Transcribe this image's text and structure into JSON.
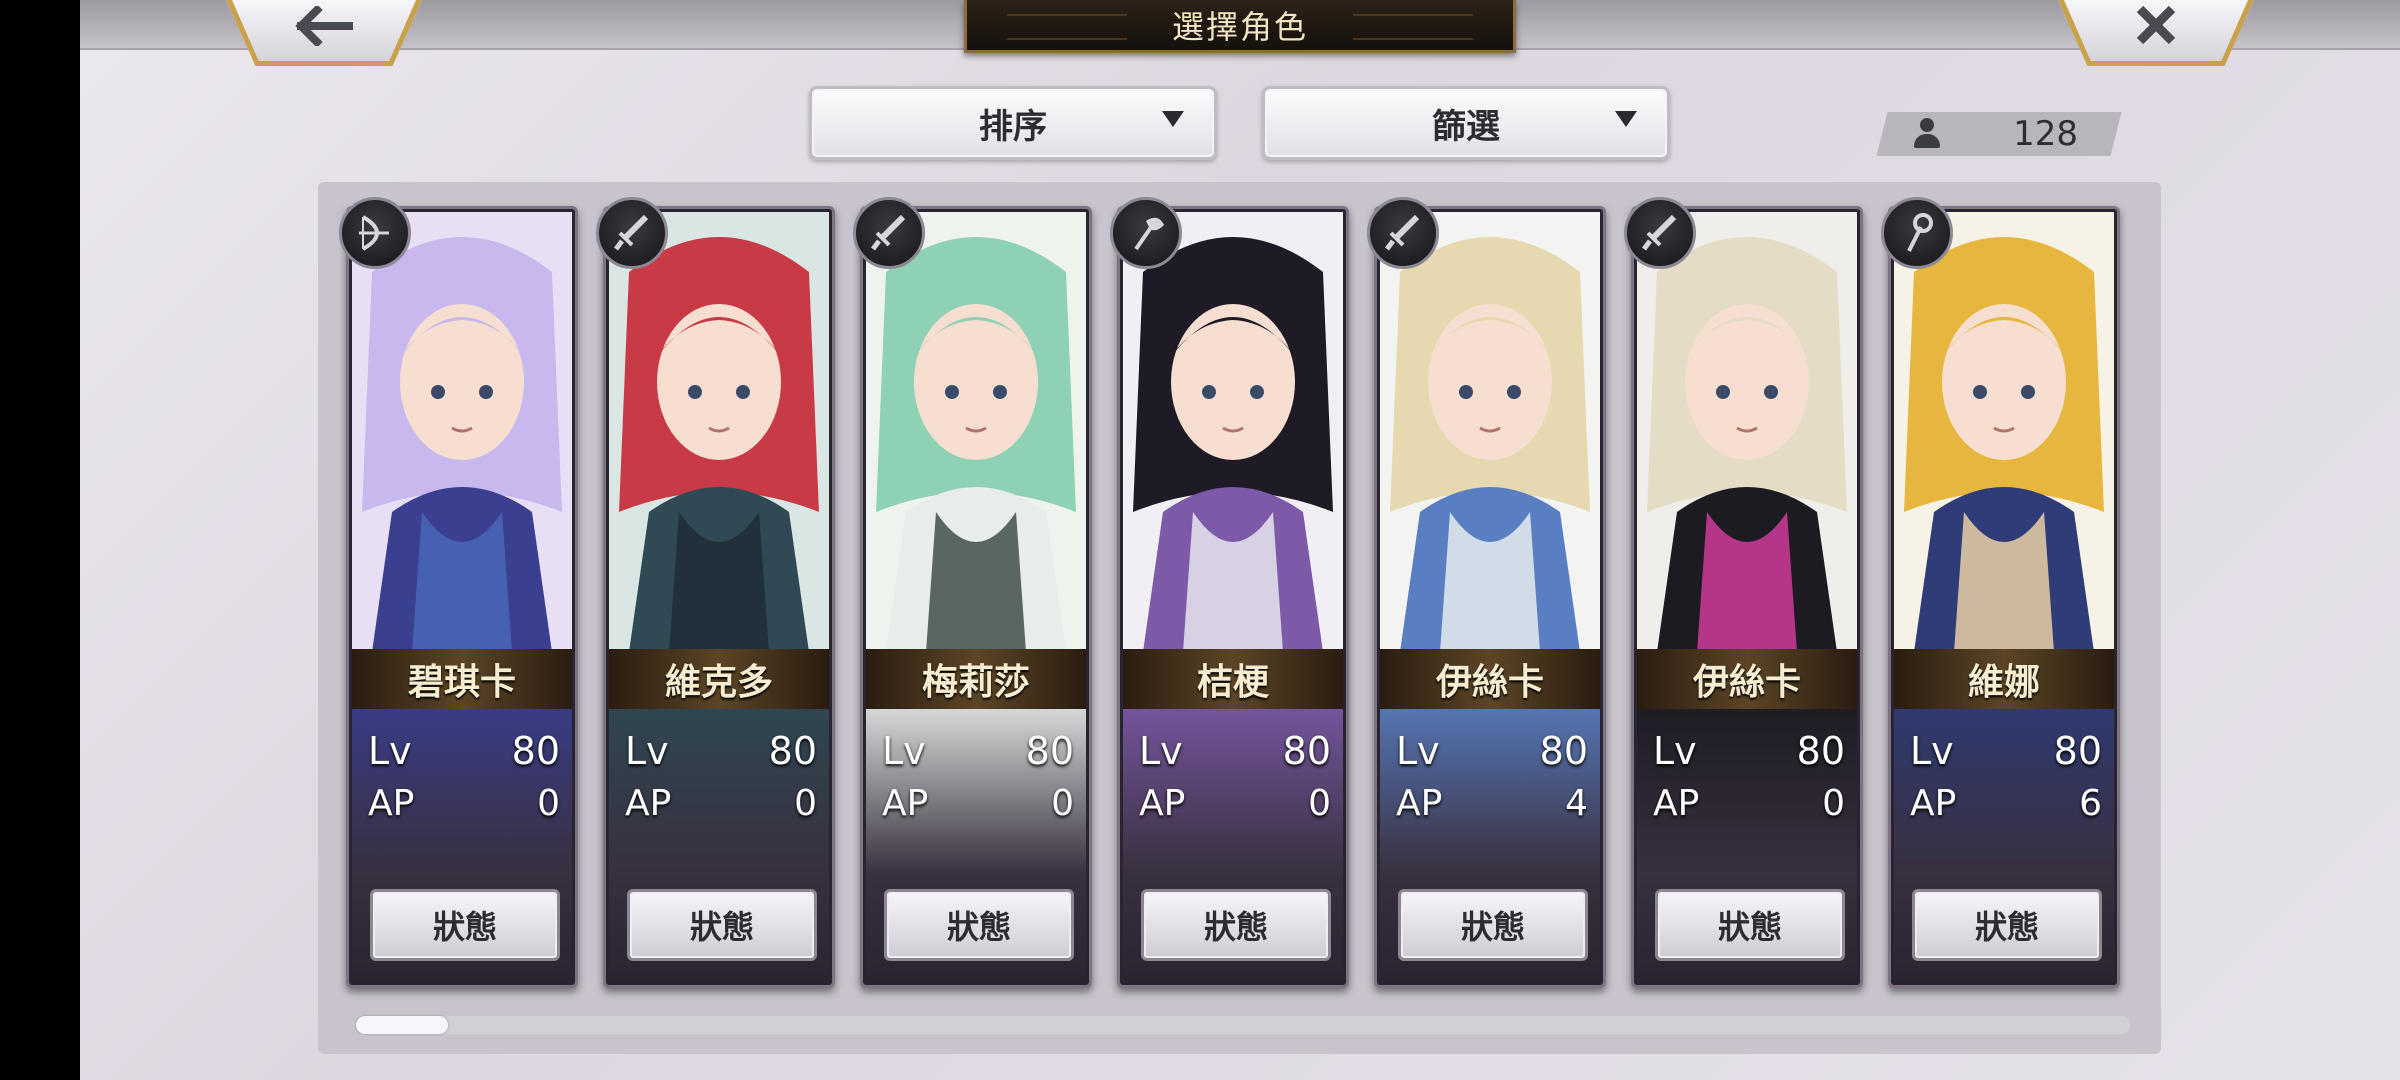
{
  "header": {
    "title": "選擇角色",
    "back_icon": "arrow-left-icon",
    "close_icon": "close-x-icon"
  },
  "toolbar": {
    "sort_label": "排序",
    "filter_label": "篩選",
    "owned_count": "128"
  },
  "stat_labels": {
    "lv": "Lv",
    "ap": "AP"
  },
  "characters": [
    {
      "name": "碧琪卡",
      "lv": "80",
      "ap": "0",
      "status_label": "狀態",
      "weapon": "bow-icon",
      "palette": [
        "#e9dff5",
        "#c9b8ee",
        "#3b3f8f",
        "#4a67b8"
      ]
    },
    {
      "name": "維克多",
      "lv": "80",
      "ap": "0",
      "status_label": "狀態",
      "weapon": "sword-icon",
      "palette": [
        "#d9e6e3",
        "#c83a45",
        "#2f4a55",
        "#1f2c36"
      ]
    },
    {
      "name": "梅莉莎",
      "lv": "80",
      "ap": "0",
      "status_label": "狀態",
      "weapon": "sword-icon",
      "palette": [
        "#eef3ee",
        "#8fd1b4",
        "#e8ecea",
        "#3f5048"
      ]
    },
    {
      "name": "桔梗",
      "lv": "80",
      "ap": "0",
      "status_label": "狀態",
      "weapon": "axe-icon",
      "palette": [
        "#f1eef4",
        "#1f1b26",
        "#7c5aa8",
        "#e9e6ee"
      ]
    },
    {
      "name": "伊絲卡",
      "lv": "80",
      "ap": "4",
      "status_label": "狀態",
      "weapon": "sword-icon",
      "palette": [
        "#f3f3f1",
        "#e6d9b0",
        "#5a7ec2",
        "#e8ecef"
      ]
    },
    {
      "name": "伊絲卡",
      "lv": "80",
      "ap": "0",
      "status_label": "狀態",
      "weapon": "sword-icon",
      "palette": [
        "#f0eeea",
        "#e4dcc4",
        "#1c1b22",
        "#d03a9a"
      ]
    },
    {
      "name": "維娜",
      "lv": "80",
      "ap": "6",
      "status_label": "狀態",
      "weapon": "staff-icon",
      "palette": [
        "#f7f2e6",
        "#e7b63f",
        "#2f3c78",
        "#e7cfa5"
      ]
    }
  ],
  "colors": {
    "accent_gold": "#c7a24a",
    "panel": "#c8c3cc",
    "title_bg": "#1c150e"
  }
}
